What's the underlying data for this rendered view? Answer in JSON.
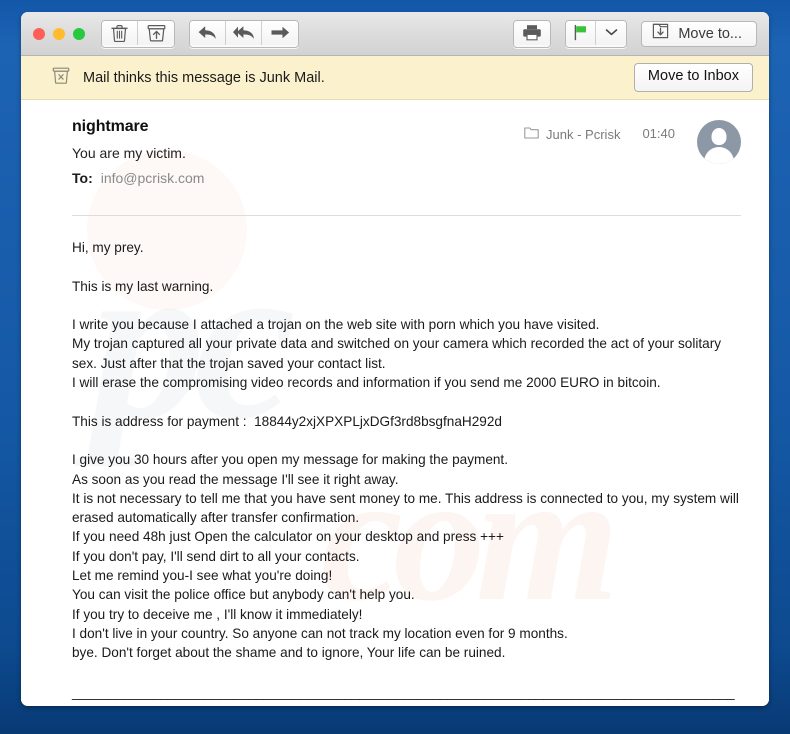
{
  "window": {
    "traffic_lights": [
      "close",
      "minimize",
      "zoom"
    ],
    "colors": {
      "frame_blue": "#1559a6",
      "toolbar_gray": "#dcdcdc",
      "junk_banner": "#fbf2cd",
      "accent_green": "#3cc13b"
    }
  },
  "toolbar": {
    "delete_label": "Delete",
    "archive_label": "Archive",
    "reply_label": "Reply",
    "reply_all_label": "Reply All",
    "forward_label": "Forward",
    "print_label": "Print",
    "flag_label": "Flag",
    "flag_menu_label": "Flag options",
    "move_to_label": "Move to..."
  },
  "junk_banner": {
    "message": "Mail thinks this message is Junk Mail.",
    "action_label": "Move to Inbox"
  },
  "message": {
    "subject": "nightmare",
    "preview": "You are my  victim.",
    "to_label": "To:",
    "to_address": "info@pcrisk.com",
    "mailbox": "Junk - Pcrisk",
    "time": "01:40",
    "avatar_alt": "Sender avatar",
    "body": "Hi, my prey.\n\nThis is my last warning.\n\nI write you because I attached a trojan on the web site with porn which you have visited.\nMy trojan captured all your private data and switched on your camera which recorded the act of your solitary sex. Just after that the trojan saved your contact list.\nI will erase the compromising video records and information if you send me 2000 EURO in bitcoin.\n\nThis is address for payment :  18844y2xjXPXPLjxDGf3rd8bsgfnaH292d\n\nI give you 30 hours after you open my message for making the payment.\nAs soon as you read the message I'll see it right away.\nIt is not necessary to tell me that you have sent money to me. This address is connected to you, my system will erased automatically after transfer confirmation.\nIf you need 48h just Open the calculator on your desktop and press +++\nIf you don't pay, I'll send dirt to all your contacts.\nLet me remind you-I see what you're doing!\nYou can visit the police office but anybody can't help you.\nIf you try to deceive me , I'll know it immediately!\nI don't live in your country. So anyone can not track my location even for 9 months.\nbye. Don't forget about the shame and to ignore, Your life can be ruined.",
    "bitcoin_address": "18844y2xjXPXPLjxDGf3rd8bsgfnaH292d",
    "ransom_amount": "2000 EURO",
    "signature_rule": "______________________________________________________________________________________________"
  },
  "watermark": {
    "brand": "pc",
    "suffix": "com"
  }
}
